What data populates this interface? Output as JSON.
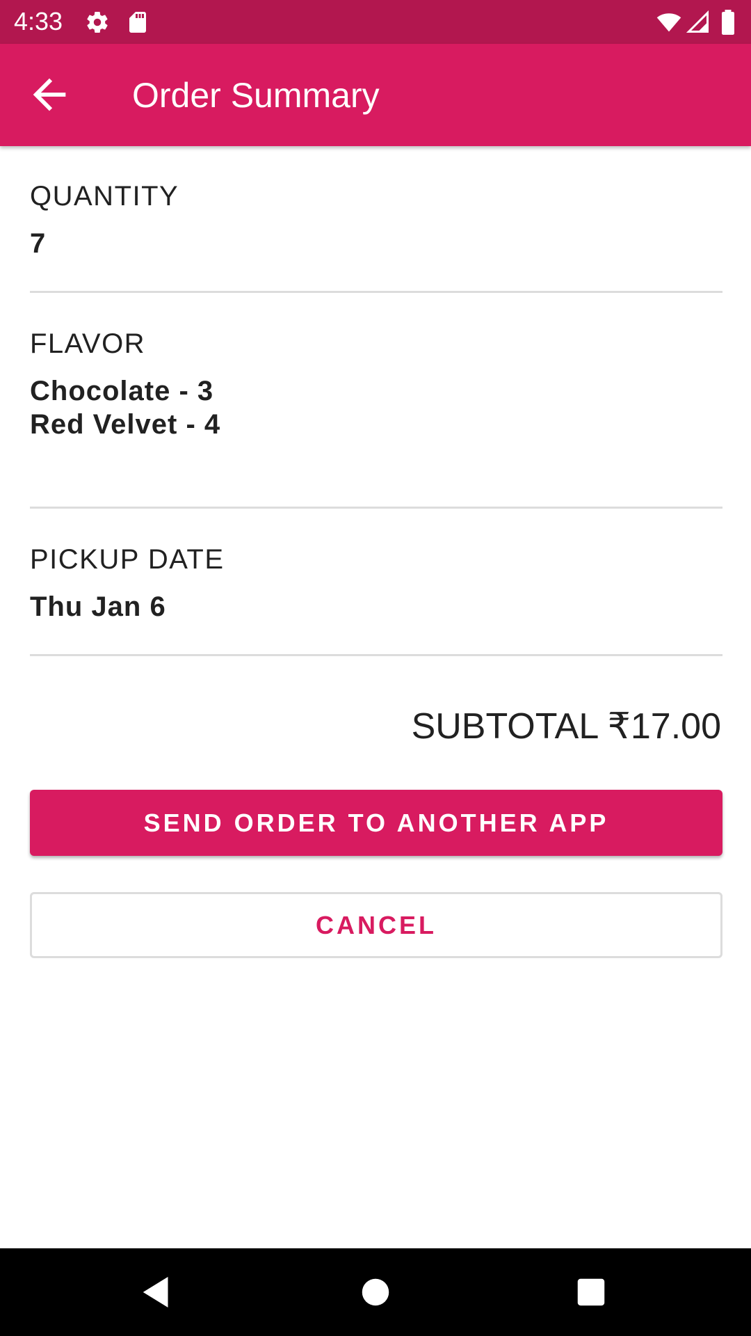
{
  "status_bar": {
    "time": "4:33",
    "icons": [
      "settings-icon",
      "sd-card-icon",
      "wifi-icon",
      "signal-icon",
      "battery-icon"
    ]
  },
  "app_bar": {
    "title": "Order Summary",
    "back_icon": "arrow-back-icon"
  },
  "sections": {
    "quantity": {
      "label": "QUANTITY",
      "value": "7"
    },
    "flavor": {
      "label": "FLAVOR",
      "values": [
        "Chocolate - 3",
        "Red Velvet - 4"
      ]
    },
    "pickup": {
      "label": "PICKUP DATE",
      "value": "Thu Jan 6"
    }
  },
  "subtotal": "SUBTOTAL ₹17.00",
  "buttons": {
    "send": "SEND ORDER TO ANOTHER APP",
    "cancel": "CANCEL"
  },
  "nav_bar": {
    "icons": [
      "back-triangle-icon",
      "home-circle-icon",
      "recents-square-icon"
    ]
  },
  "colors": {
    "primary": "#d81b60",
    "primary_dark": "#b2174f",
    "text": "#212121",
    "divider": "#dcdcdc"
  }
}
